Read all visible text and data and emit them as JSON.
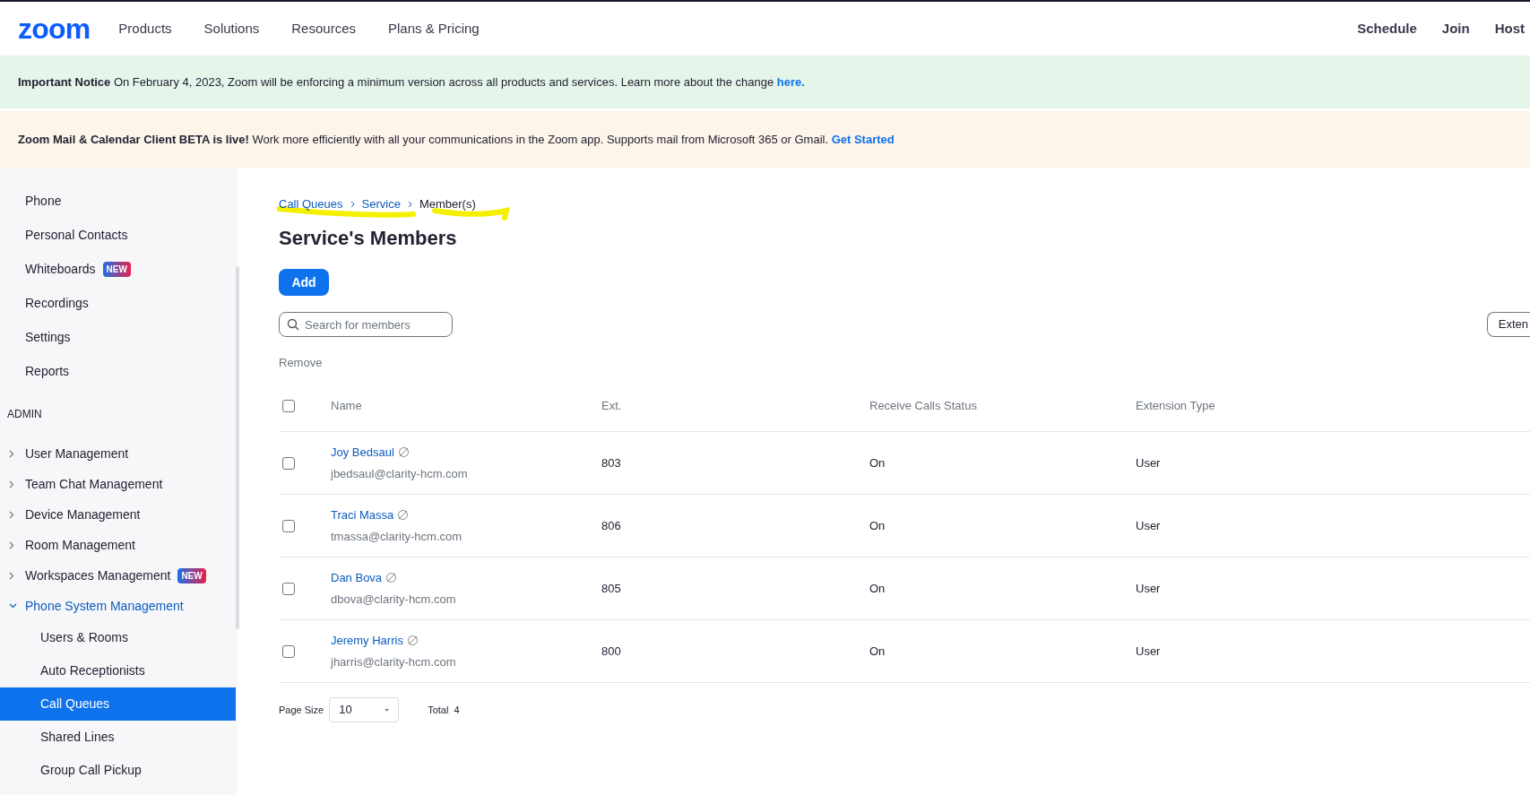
{
  "nav": {
    "logo": "zoom",
    "menu": [
      "Products",
      "Solutions",
      "Resources",
      "Plans & Pricing"
    ],
    "actions": [
      "Schedule",
      "Join",
      "Host"
    ]
  },
  "notices": [
    {
      "title": "Important Notice",
      "body": "On February 4, 2023, Zoom will be enforcing a minimum version across all products and services. Learn more about the change",
      "link": "here.",
      "color": "#e5f5ea"
    },
    {
      "title": "Zoom Mail & Calendar Client BETA is live!",
      "body": "Work more efficiently with all your communications in the Zoom app. Supports mail from Microsoft 365 or Gmail.",
      "link": "Get Started",
      "color": "#fdf4ea"
    }
  ],
  "sidebar": {
    "items": [
      {
        "kind": "item",
        "label": "Phone",
        "selected": false
      },
      {
        "kind": "item",
        "label": "Personal Contacts",
        "selected": false
      },
      {
        "kind": "item",
        "label": "Whiteboards",
        "badge": "NEW",
        "selected": false
      },
      {
        "kind": "item",
        "label": "Recordings",
        "selected": false
      },
      {
        "kind": "item",
        "label": "Settings",
        "selected": false
      },
      {
        "kind": "item",
        "label": "Reports",
        "selected": false
      },
      {
        "kind": "section",
        "label": "ADMIN"
      },
      {
        "kind": "group",
        "label": "User Management",
        "expanded": false
      },
      {
        "kind": "group",
        "label": "Team Chat Management",
        "expanded": false
      },
      {
        "kind": "group",
        "label": "Device Management",
        "expanded": false
      },
      {
        "kind": "group",
        "label": "Room Management",
        "expanded": false
      },
      {
        "kind": "group",
        "label": "Workspaces Management",
        "badge": "NEW",
        "expanded": false
      },
      {
        "kind": "group",
        "label": "Phone System Management",
        "expanded": true,
        "children": [
          {
            "label": "Users & Rooms",
            "selected": false
          },
          {
            "label": "Auto Receptionists",
            "selected": false
          },
          {
            "label": "Call Queues",
            "selected": true
          },
          {
            "label": "Shared Lines",
            "selected": false
          },
          {
            "label": "Group Call Pickup",
            "selected": false
          }
        ]
      }
    ]
  },
  "breadcrumb": [
    {
      "kind": "link",
      "label": "Call Queues"
    },
    {
      "kind": "link",
      "label": "Service"
    },
    {
      "kind": "current",
      "label": "Member(s)"
    }
  ],
  "title": "Service's Members",
  "add_button": "Add",
  "search": {
    "placeholder": "Search for members"
  },
  "right_button": "Exten",
  "remove_action": "Remove",
  "table": {
    "select_all_checked": false,
    "columns": [
      "Name",
      "Ext.",
      "Receive Calls Status",
      "Extension Type"
    ],
    "rows": [
      {
        "checked": false,
        "name": "Joy Bedsaul",
        "email": "jbedsaul@clarity-hcm.com",
        "ext": "803",
        "status": "On",
        "type": "User"
      },
      {
        "checked": false,
        "name": "Traci Massa",
        "email": "tmassa@clarity-hcm.com",
        "ext": "806",
        "status": "On",
        "type": "User"
      },
      {
        "checked": false,
        "name": "Dan Bova",
        "email": "dbova@clarity-hcm.com",
        "ext": "805",
        "status": "On",
        "type": "User"
      },
      {
        "checked": false,
        "name": "Jeremy Harris",
        "email": "jharris@clarity-hcm.com",
        "ext": "800",
        "status": "On",
        "type": "User"
      }
    ]
  },
  "pagination": {
    "page_size_label": "Page Size",
    "page_size": "10",
    "total_label": "Total",
    "total": "4"
  }
}
